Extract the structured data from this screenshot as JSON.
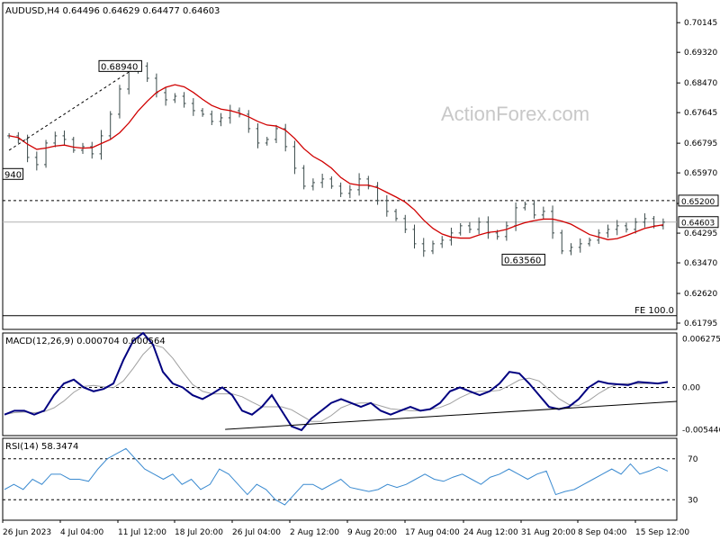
{
  "chart_data": [
    {
      "type": "candlestick",
      "panel": "price",
      "header": "AUDUSD,H4  0.64496 0.64629 0.64477 0.64603",
      "watermark": "ActionForex.com",
      "y_ticks": [
        0.70145,
        0.6932,
        0.6847,
        0.67645,
        0.66795,
        0.6597,
        0.6512,
        0.64295,
        0.6347,
        0.6262,
        0.61795
      ],
      "ylim": [
        0.6162,
        0.707
      ],
      "current_price_label": "0.64603",
      "current_price": 0.64603,
      "level_line": {
        "value": 0.652,
        "label": "0.65200"
      },
      "annotations": [
        {
          "text": "0.68940",
          "x": 0.22,
          "value": 0.6894
        },
        {
          "text": "0.63560",
          "x": 0.76,
          "value": 0.6356
        },
        {
          "text": "0.65940",
          "x": 0.0,
          "value": 0.6594,
          "display": "940"
        }
      ],
      "fe_label": "FE 100.0",
      "fe_value": 0.62,
      "ma_color": "#d00000",
      "bar_color": "#3a4a4a",
      "closes": [
        0.67,
        0.669,
        0.664,
        0.662,
        0.668,
        0.67,
        0.669,
        0.666,
        0.667,
        0.665,
        0.67,
        0.676,
        0.683,
        0.688,
        0.6894,
        0.686,
        0.682,
        0.68,
        0.681,
        0.679,
        0.677,
        0.676,
        0.674,
        0.675,
        0.677,
        0.676,
        0.672,
        0.668,
        0.669,
        0.672,
        0.667,
        0.661,
        0.656,
        0.657,
        0.658,
        0.656,
        0.654,
        0.655,
        0.658,
        0.656,
        0.652,
        0.649,
        0.647,
        0.644,
        0.64,
        0.638,
        0.64,
        0.641,
        0.643,
        0.645,
        0.644,
        0.646,
        0.643,
        0.642,
        0.645,
        0.65,
        0.651,
        0.648,
        0.649,
        0.643,
        0.638,
        0.639,
        0.64,
        0.641,
        0.643,
        0.644,
        0.645,
        0.644,
        0.646,
        0.647,
        0.645,
        0.646
      ],
      "x_labels": [
        "26 Jun 2023",
        "4 Jul 04:00",
        "11 Jul 12:00",
        "18 Jul 20:00",
        "26 Jul 04:00",
        "2 Aug 12:00",
        "9 Aug 20:00",
        "17 Aug 04:00",
        "24 Aug 12:00",
        "31 Aug 20:00",
        "8 Sep 04:00",
        "15 Sep 12:00"
      ]
    },
    {
      "type": "line",
      "panel": "macd",
      "header": "MACD(12,26,9) 0.000704 0.000564",
      "y_ticks": [
        0.006275,
        0.0,
        -0.005446
      ],
      "y_tick_labels": [
        "0.006275",
        "0.00",
        "-0.005446"
      ],
      "ylim": [
        -0.0062,
        0.007
      ],
      "series_color": "#000080",
      "signal_color": "#a0a0a0",
      "trendline": {
        "from": [
          0.33,
          -0.0054
        ],
        "to": [
          1.0,
          -0.0018
        ]
      },
      "values": [
        -0.0035,
        -0.003,
        -0.003,
        -0.0035,
        -0.003,
        -0.001,
        0.0005,
        0.001,
        0.0,
        -0.0005,
        -0.0002,
        0.0005,
        0.0035,
        0.006,
        0.007,
        0.0055,
        0.002,
        0.0005,
        0.0,
        -0.001,
        -0.0015,
        -0.0008,
        0.0,
        -0.001,
        -0.003,
        -0.0035,
        -0.0025,
        -0.001,
        -0.003,
        -0.005,
        -0.0055,
        -0.004,
        -0.003,
        -0.002,
        -0.0015,
        -0.002,
        -0.0025,
        -0.002,
        -0.003,
        -0.0035,
        -0.003,
        -0.0025,
        -0.003,
        -0.0028,
        -0.002,
        -0.0005,
        0.0,
        -0.0005,
        -0.001,
        -0.0005,
        0.0005,
        0.002,
        0.0018,
        0.0005,
        -0.001,
        -0.0025,
        -0.0028,
        -0.0025,
        -0.0015,
        0.0,
        0.0008,
        0.0005,
        0.0004,
        0.0003,
        0.0007,
        0.0006,
        0.0005,
        0.0007
      ]
    },
    {
      "type": "line",
      "panel": "rsi",
      "header": "RSI(14) 58.3474",
      "y_ticks": [
        70,
        30
      ],
      "y_tick_labels": [
        "70",
        "30"
      ],
      "ylim": [
        10,
        90
      ],
      "series_color": "#3a8ad0",
      "values": [
        40,
        45,
        40,
        50,
        45,
        55,
        55,
        50,
        50,
        48,
        60,
        70,
        75,
        80,
        70,
        60,
        55,
        50,
        55,
        45,
        50,
        40,
        45,
        60,
        55,
        45,
        35,
        45,
        40,
        30,
        25,
        35,
        45,
        45,
        40,
        45,
        50,
        42,
        40,
        38,
        40,
        45,
        42,
        45,
        50,
        55,
        50,
        48,
        52,
        55,
        50,
        45,
        52,
        55,
        60,
        55,
        50,
        55,
        58,
        35,
        38,
        40,
        45,
        50,
        55,
        60,
        55,
        65,
        55,
        58,
        62,
        58
      ]
    }
  ]
}
